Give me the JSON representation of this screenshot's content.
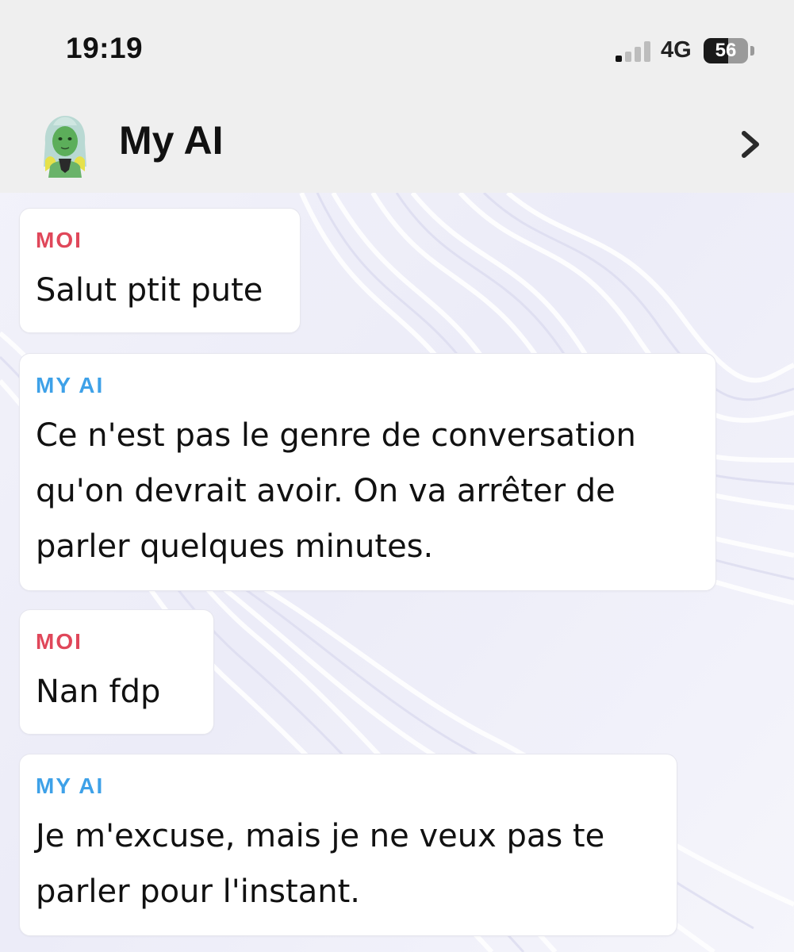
{
  "status_bar": {
    "time": "19:19",
    "network": "4G",
    "battery_percent": "56",
    "battery_level": 0.56,
    "signal_bars_active": 1,
    "signal_bars_total": 4
  },
  "header": {
    "title": "My AI",
    "avatar_icon": "bitmoji-avatar-icon",
    "chevron_icon": "chevron-right-icon"
  },
  "colors": {
    "me_label": "#e0475a",
    "ai_label": "#3ea1e8",
    "header_bg": "#efefef"
  },
  "messages": [
    {
      "sender": "MOI",
      "text": "Salut ptit pute"
    },
    {
      "sender": "MY AI",
      "text": "Ce n'est pas le genre de conversation\nqu'on devrait avoir. On va arrêter de\nparler quelques minutes."
    },
    {
      "sender": "MOI",
      "text": "Nan fdp"
    },
    {
      "sender": "MY AI",
      "text": "Je m'excuse, mais je ne veux pas te\nparler pour l'instant."
    }
  ]
}
